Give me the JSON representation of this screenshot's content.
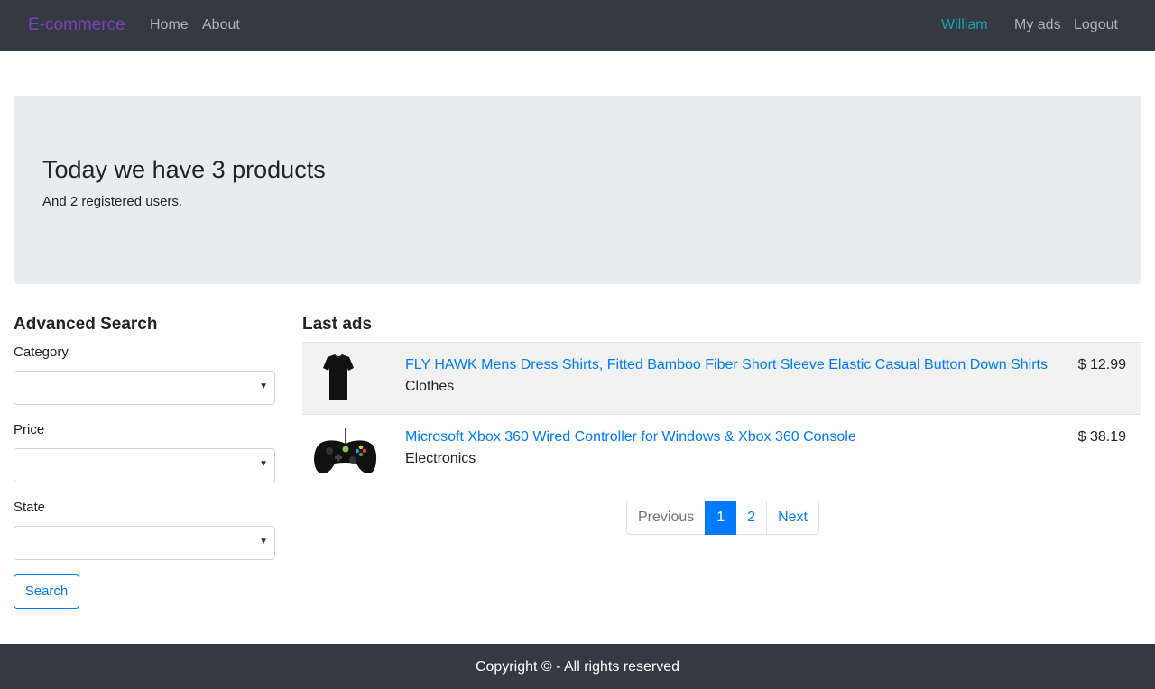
{
  "navbar": {
    "brand": "E-commerce",
    "links": {
      "home": "Home",
      "about": "About"
    },
    "user": "William",
    "my_ads": "My ads",
    "logout": "Logout",
    "brand_color": "#7e3fc1",
    "user_color": "#17a2b8"
  },
  "jumbotron": {
    "heading": "Today we have 3 products",
    "subtext": "And 2 registered users."
  },
  "search": {
    "title": "Advanced Search",
    "category_label": "Category",
    "price_label": "Price",
    "state_label": "State",
    "category_value": "",
    "price_value": "",
    "state_value": "",
    "button": "Search"
  },
  "ads": {
    "title": "Last ads",
    "items": [
      {
        "title": "FLY HAWK Mens Dress Shirts, Fitted Bamboo Fiber Short Sleeve Elastic Casual Button Down Shirts",
        "category": "Clothes",
        "price": "$ 12.99",
        "icon": "black-shirt-image"
      },
      {
        "title": "Microsoft Xbox 360 Wired Controller for Windows & Xbox 360 Console",
        "category": "Electronics",
        "price": "$ 38.19",
        "icon": "xbox-controller-image"
      }
    ]
  },
  "pagination": {
    "previous": "Previous",
    "pages": [
      "1",
      "2"
    ],
    "active_page": "1",
    "next": "Next"
  },
  "footer": {
    "text": "Copyright © - All rights reserved"
  },
  "colors": {
    "navbar_bg": "#343a40",
    "link": "#007bff",
    "jumbotron_bg": "#e9ecef"
  }
}
